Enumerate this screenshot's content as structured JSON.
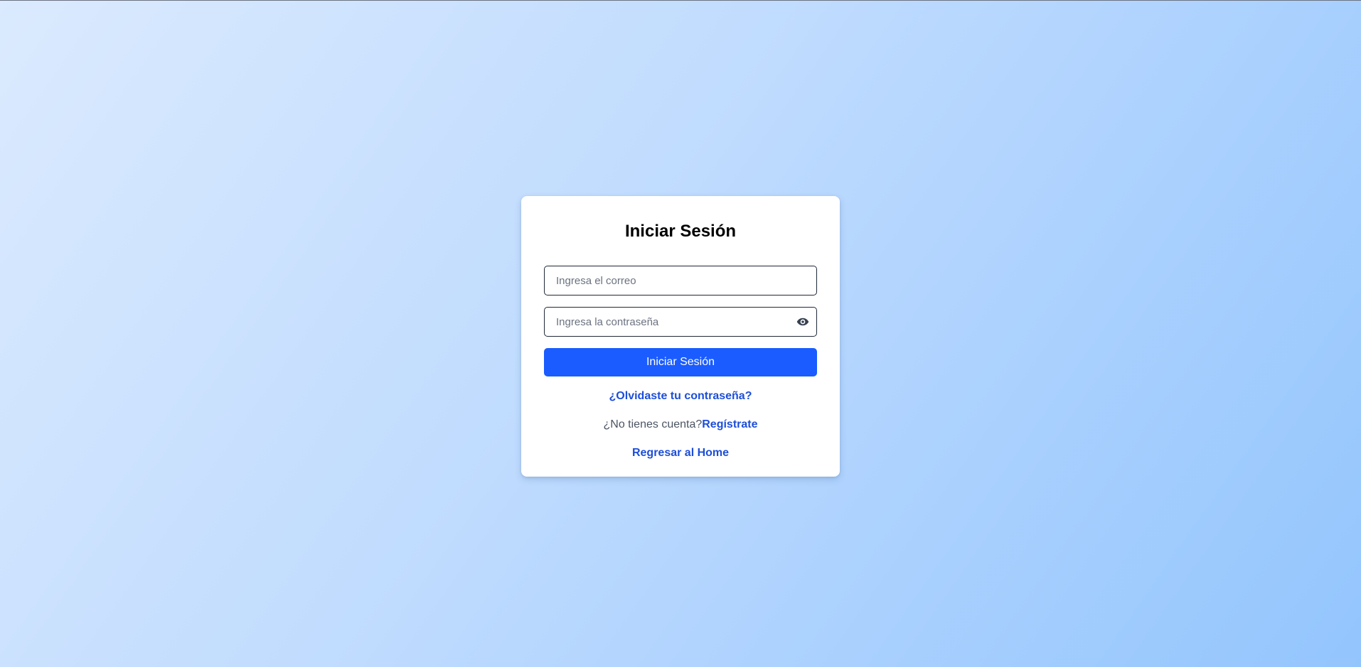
{
  "login": {
    "title": "Iniciar Sesión",
    "email_placeholder": "Ingresa el correo",
    "email_value": "",
    "password_placeholder": "Ingresa la contraseña",
    "password_value": "",
    "password_toggle_icon": "eye-icon",
    "submit_label": "Iniciar Sesión",
    "forgot_link": "¿Olvidaste tu contraseña?",
    "no_account_text": "¿No tienes cuenta?",
    "register_link": "Regístrate",
    "home_link": "Regresar al Home"
  },
  "colors": {
    "primary": "#1a5cff",
    "link": "#1d4ed8",
    "background_start": "#dbeafe",
    "background_end": "#93c5fd"
  }
}
